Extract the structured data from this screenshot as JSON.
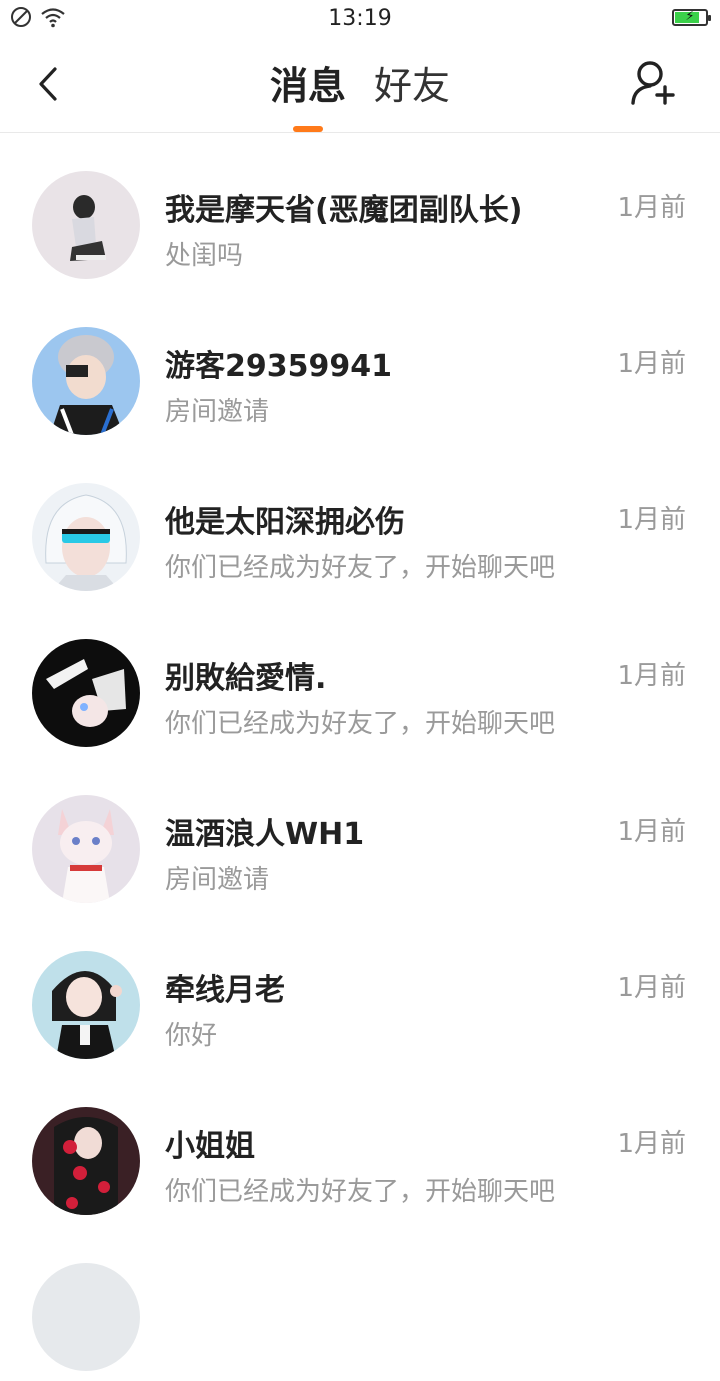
{
  "status_bar": {
    "time": "13:19",
    "icons": [
      "do-not-disturb-icon",
      "wifi-icon",
      "battery-charging-icon"
    ],
    "battery_level": 0.75,
    "battery_color": "#3bd14a"
  },
  "header": {
    "tabs": [
      {
        "label": "消息",
        "active": true
      },
      {
        "label": "好友",
        "active": false
      }
    ],
    "accent_color": "#ff7a1a"
  },
  "conversations": [
    {
      "name": "我是摩天省(恶魔团副队长)",
      "preview": "处闺吗",
      "time": "1月前"
    },
    {
      "name": "游客29359941",
      "preview": "房间邀请",
      "time": "1月前"
    },
    {
      "name": "他是太阳深拥必伤",
      "preview": "你们已经成为好友了，开始聊天吧",
      "time": "1月前"
    },
    {
      "name": "别敗給愛情.",
      "preview": "你们已经成为好友了，开始聊天吧",
      "time": "1月前"
    },
    {
      "name": "温酒浪人WH1",
      "preview": "房间邀请",
      "time": "1月前"
    },
    {
      "name": "牵线月老",
      "preview": "你好",
      "time": "1月前"
    },
    {
      "name": "小姐姐",
      "preview": "你们已经成为好友了，开始聊天吧",
      "time": "1月前"
    }
  ]
}
